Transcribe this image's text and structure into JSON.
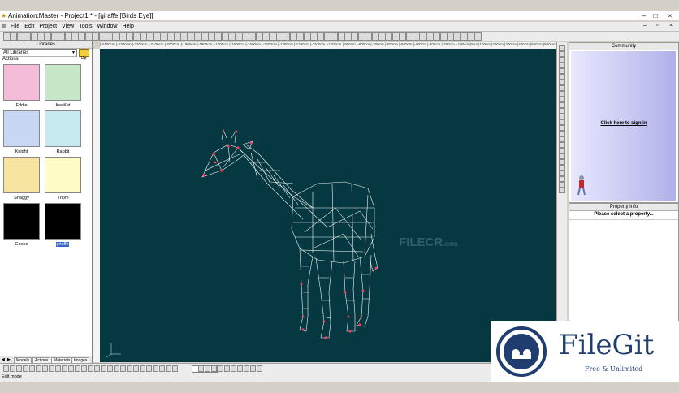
{
  "window": {
    "title": "Animation:Master - Project1 * - [giraffe [Birds Eye]]",
    "buttons": [
      "–",
      "□",
      "×"
    ],
    "inner_buttons": [
      "–",
      "▫",
      "×"
    ]
  },
  "menu": [
    "File",
    "Edit",
    "Project",
    "View",
    "Tools",
    "Window",
    "Help"
  ],
  "libraries": {
    "title": "Libraries",
    "dropdown_value": "All Libraries",
    "category": "Actions",
    "up_label": "Up",
    "items": [
      {
        "label": "Eddie",
        "color": "#f4bcd8"
      },
      {
        "label": "KeeKat",
        "color": "#c6e8c8"
      },
      {
        "label": "Knight",
        "color": "#c8d8f4"
      },
      {
        "label": "Rabbit",
        "color": "#c6eaf0"
      },
      {
        "label": "Shaggy",
        "color": "#f6e4a0"
      },
      {
        "label": "Thom",
        "color": "#fffcc8"
      },
      {
        "label": "Goose",
        "color": "#000000"
      },
      {
        "label": "giraffe",
        "color": "#000000"
      }
    ],
    "tabs": [
      "Models",
      "Actions",
      "Materials",
      "Images"
    ]
  },
  "viewport": {
    "ruler_top": "|-2400cm |-2300cm |-2200cm |-2100cm |-2000cm |-1900cm |-1800cm |-1700cm |-1600cm |-1500cm |-1400cm |-1300cm |-1200cm |-1100cm |-1000cm |-900cm |-800cm |-700cm |-600cm |-500cm |-400cm |-300cm |-200cm |-100cm |0cm |100cm |200cm |300cm |400cm |500cm |600cm |700cm |800cm |900cm |1000cm |1100cm |1200cm |1300cm |1400cm |1500cm |1600cm |1700cm |1800cm |1900cm |2000cm |2100cm |2200cm |2300cm |2400cm",
    "background": "#053840",
    "wire_color": "#ffffff",
    "accent": "#ff3b5c",
    "watermark": "FILECR",
    "watermark_suffix": ".com"
  },
  "community": {
    "title": "Community",
    "link": "Click here to sign in"
  },
  "properties": {
    "title": "Property Info",
    "message": "Please select a property..."
  },
  "status": {
    "left": "Edit mode",
    "right": "9"
  },
  "filegit": {
    "name": "FileGit",
    "tagline": "Free & Unlimited",
    "color": "#1f3d6e"
  }
}
